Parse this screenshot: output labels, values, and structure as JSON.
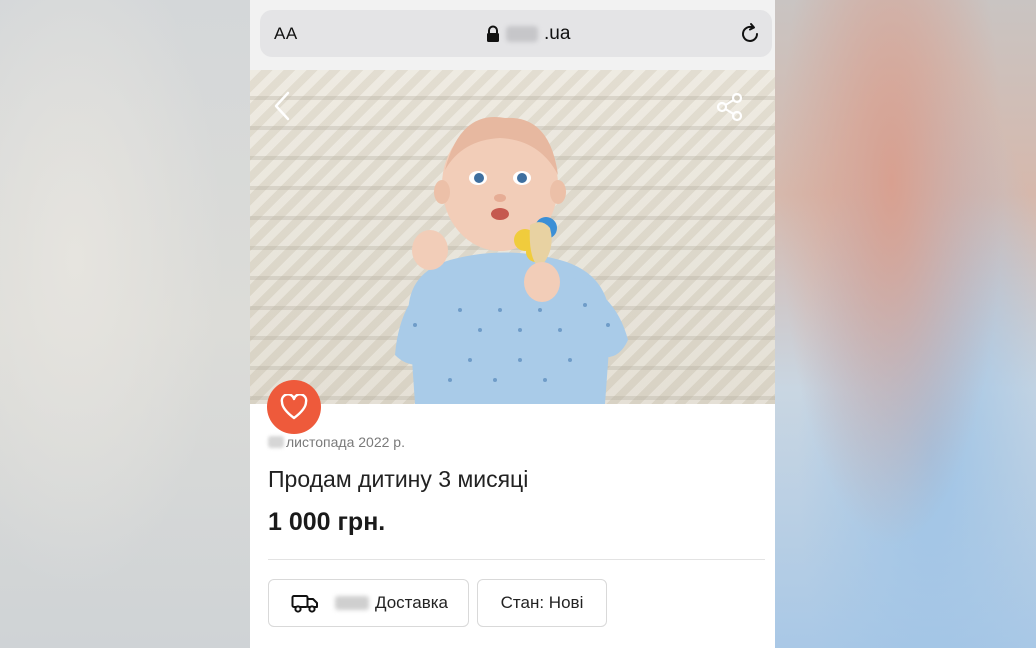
{
  "browser": {
    "text_size_button": "AA",
    "url_suffix": ".ua"
  },
  "listing": {
    "date_text": "листопада 2022 р.",
    "title": "Продам дитину 3 мисяці",
    "price": "1 000 грн.",
    "tags": {
      "delivery_label": "Доставка",
      "condition_label": "Стан: Нові"
    }
  },
  "icons": {
    "back": "chevron-left-icon",
    "share": "share-icon",
    "favorite": "heart-icon",
    "lock": "lock-icon",
    "reload": "reload-icon",
    "delivery": "truck-icon"
  },
  "colors": {
    "favorite_button": "#ee5a3b",
    "page_bg": "#ffffff"
  }
}
